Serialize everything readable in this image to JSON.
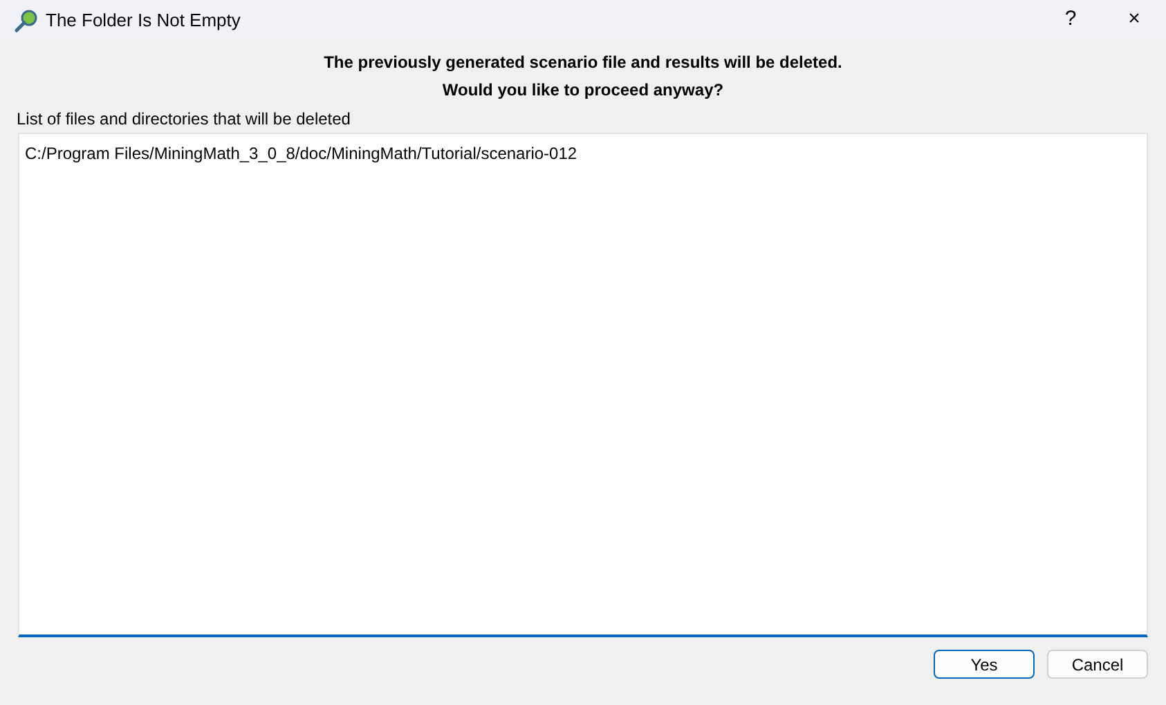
{
  "window": {
    "title": "The Folder Is Not Empty",
    "controls": [
      "?",
      "×"
    ]
  },
  "message": [
    "The previously generated scenario file and results will be deleted.",
    "Would you like to proceed anyway?"
  ],
  "list_label": "List of files and directories that will be deleted",
  "list_text": "C:/Program Files/MiningMath_3_0_8/doc/MiningMath/Tutorial/scenario-012",
  "buttons": [
    {
      "label": "Yes",
      "default": true
    },
    {
      "label": "Cancel",
      "default": false
    }
  ]
}
